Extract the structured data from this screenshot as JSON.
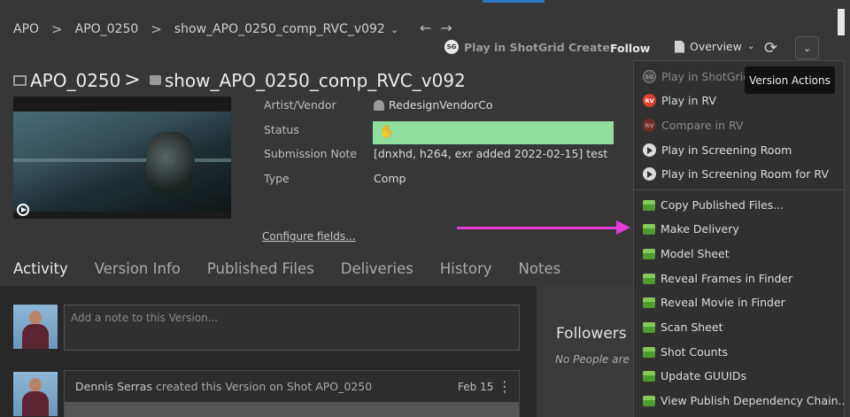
{
  "breadcrumb": {
    "project": "APO",
    "shot": "APO_0250",
    "version": "show_APO_0250_comp_RVC_v092"
  },
  "header": {
    "play_create_label": "Play in ShotGrid Create",
    "follow_label": "Follow",
    "overview_label": "Overview",
    "sg_badge": "SG"
  },
  "title": {
    "shot": "APO_0250",
    "version": "show_APO_0250_comp_RVC_v092"
  },
  "fields": [
    {
      "label": "Artist/Vendor",
      "value": "RedesignVendorCo"
    },
    {
      "label": "Status",
      "value": ""
    },
    {
      "label": "Submission Note",
      "value": "[dnxhd, h264, exr added 2022-02-15] test"
    },
    {
      "label": "Type",
      "value": "Comp"
    }
  ],
  "status_color": "#8fde9e",
  "configure_label": "Configure fields...",
  "tabs": [
    "Activity",
    "Version Info",
    "Published Files",
    "Deliveries",
    "History",
    "Notes"
  ],
  "note_placeholder": "Add a note to this Version...",
  "activity": {
    "user": "Dennis Serras",
    "text": "created this Version on Shot APO_0250",
    "date": "Feb 15"
  },
  "followers": {
    "title": "Followers",
    "empty": "No People are c"
  },
  "tooltip": "Version Actions",
  "menu": {
    "items": [
      {
        "label": "Play in ShotGrid",
        "icon": "sg-icon",
        "badge": "SG",
        "dim": true
      },
      {
        "label": "Play in RV",
        "icon": "rv-icon",
        "badge": "RV",
        "dim": false
      },
      {
        "label": "Compare in RV",
        "icon": "rv-icon",
        "badge": "RV",
        "dim": true
      },
      {
        "label": "Play in Screening Room",
        "icon": "play-icon",
        "badge": "",
        "dim": false
      },
      {
        "label": "Play in Screening Room for RV",
        "icon": "play-icon",
        "badge": "",
        "dim": false
      },
      {
        "label": "Copy Published Files...",
        "icon": "box-icon",
        "badge": "",
        "dim": false
      },
      {
        "label": "Make Delivery",
        "icon": "box-icon",
        "badge": "",
        "dim": false
      },
      {
        "label": "Model Sheet",
        "icon": "box-icon",
        "badge": "",
        "dim": false
      },
      {
        "label": "Reveal Frames in Finder",
        "icon": "box-icon",
        "badge": "",
        "dim": false
      },
      {
        "label": "Reveal Movie in Finder",
        "icon": "box-icon",
        "badge": "",
        "dim": false
      },
      {
        "label": "Scan Sheet",
        "icon": "box-icon",
        "badge": "",
        "dim": false
      },
      {
        "label": "Shot Counts",
        "icon": "box-icon",
        "badge": "",
        "dim": false
      },
      {
        "label": "Update GUUIDs",
        "icon": "box-icon",
        "badge": "",
        "dim": false
      },
      {
        "label": "View Publish Dependency Chain...",
        "icon": "box-icon",
        "badge": "",
        "dim": false
      }
    ]
  },
  "annotation_color": "#e53bd7"
}
